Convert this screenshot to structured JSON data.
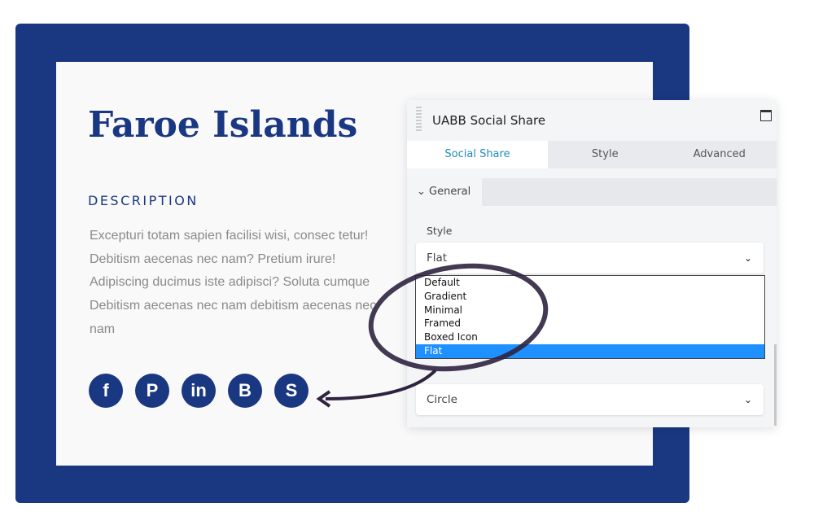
{
  "card": {
    "title": "Faroe Islands",
    "description_heading": "DESCRIPTION",
    "description": "Excepturi totam sapien facilisi wisi, consec tetur! Debitism aecenas nec nam? Pretium irure! Adipiscing ducimus iste adipisci? Soluta cumque Debitism aecenas nec nam debitism aecenas nec nam",
    "social_icons": [
      {
        "name": "facebook",
        "glyph": "f"
      },
      {
        "name": "pinterest",
        "glyph": "P"
      },
      {
        "name": "linkedin",
        "glyph": "in"
      },
      {
        "name": "blogger",
        "glyph": "B"
      },
      {
        "name": "skype",
        "glyph": "S"
      }
    ]
  },
  "panel": {
    "title": "UABB Social Share",
    "tabs": [
      {
        "label": "Social Share",
        "active": true
      },
      {
        "label": "Style"
      },
      {
        "label": "Advanced"
      }
    ],
    "section": "General",
    "style_label": "Style",
    "style_value": "Flat",
    "style_options": [
      "Default",
      "Gradient",
      "Minimal",
      "Framed",
      "Boxed Icon",
      "Flat"
    ],
    "shape_value": "Circle"
  },
  "colors": {
    "brand": "#1a3781",
    "accent": "#1e8cbe",
    "highlight": "#1e90ff"
  }
}
